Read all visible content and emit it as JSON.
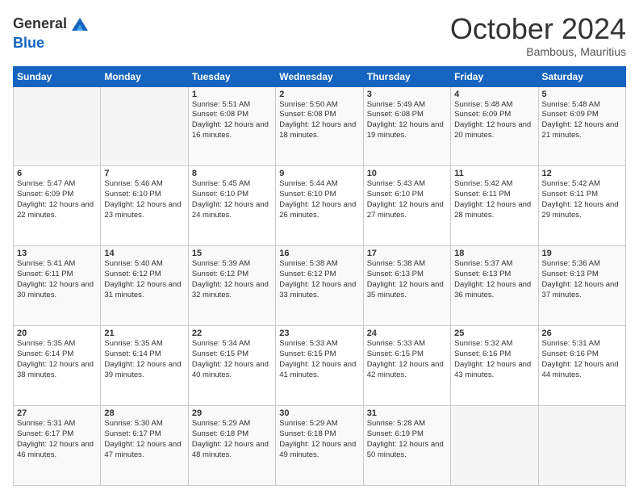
{
  "header": {
    "logo_general": "General",
    "logo_blue": "Blue",
    "month_title": "October 2024",
    "subtitle": "Bambous, Mauritius"
  },
  "weekdays": [
    "Sunday",
    "Monday",
    "Tuesday",
    "Wednesday",
    "Thursday",
    "Friday",
    "Saturday"
  ],
  "weeks": [
    [
      {
        "day": "",
        "info": ""
      },
      {
        "day": "",
        "info": ""
      },
      {
        "day": "1",
        "info": "Sunrise: 5:51 AM\nSunset: 6:08 PM\nDaylight: 12 hours and 16 minutes."
      },
      {
        "day": "2",
        "info": "Sunrise: 5:50 AM\nSunset: 6:08 PM\nDaylight: 12 hours and 18 minutes."
      },
      {
        "day": "3",
        "info": "Sunrise: 5:49 AM\nSunset: 6:08 PM\nDaylight: 12 hours and 19 minutes."
      },
      {
        "day": "4",
        "info": "Sunrise: 5:48 AM\nSunset: 6:09 PM\nDaylight: 12 hours and 20 minutes."
      },
      {
        "day": "5",
        "info": "Sunrise: 5:48 AM\nSunset: 6:09 PM\nDaylight: 12 hours and 21 minutes."
      }
    ],
    [
      {
        "day": "6",
        "info": "Sunrise: 5:47 AM\nSunset: 6:09 PM\nDaylight: 12 hours and 22 minutes."
      },
      {
        "day": "7",
        "info": "Sunrise: 5:46 AM\nSunset: 6:10 PM\nDaylight: 12 hours and 23 minutes."
      },
      {
        "day": "8",
        "info": "Sunrise: 5:45 AM\nSunset: 6:10 PM\nDaylight: 12 hours and 24 minutes."
      },
      {
        "day": "9",
        "info": "Sunrise: 5:44 AM\nSunset: 6:10 PM\nDaylight: 12 hours and 26 minutes."
      },
      {
        "day": "10",
        "info": "Sunrise: 5:43 AM\nSunset: 6:10 PM\nDaylight: 12 hours and 27 minutes."
      },
      {
        "day": "11",
        "info": "Sunrise: 5:42 AM\nSunset: 6:11 PM\nDaylight: 12 hours and 28 minutes."
      },
      {
        "day": "12",
        "info": "Sunrise: 5:42 AM\nSunset: 6:11 PM\nDaylight: 12 hours and 29 minutes."
      }
    ],
    [
      {
        "day": "13",
        "info": "Sunrise: 5:41 AM\nSunset: 6:11 PM\nDaylight: 12 hours and 30 minutes."
      },
      {
        "day": "14",
        "info": "Sunrise: 5:40 AM\nSunset: 6:12 PM\nDaylight: 12 hours and 31 minutes."
      },
      {
        "day": "15",
        "info": "Sunrise: 5:39 AM\nSunset: 6:12 PM\nDaylight: 12 hours and 32 minutes."
      },
      {
        "day": "16",
        "info": "Sunrise: 5:38 AM\nSunset: 6:12 PM\nDaylight: 12 hours and 33 minutes."
      },
      {
        "day": "17",
        "info": "Sunrise: 5:38 AM\nSunset: 6:13 PM\nDaylight: 12 hours and 35 minutes."
      },
      {
        "day": "18",
        "info": "Sunrise: 5:37 AM\nSunset: 6:13 PM\nDaylight: 12 hours and 36 minutes."
      },
      {
        "day": "19",
        "info": "Sunrise: 5:36 AM\nSunset: 6:13 PM\nDaylight: 12 hours and 37 minutes."
      }
    ],
    [
      {
        "day": "20",
        "info": "Sunrise: 5:35 AM\nSunset: 6:14 PM\nDaylight: 12 hours and 38 minutes."
      },
      {
        "day": "21",
        "info": "Sunrise: 5:35 AM\nSunset: 6:14 PM\nDaylight: 12 hours and 39 minutes."
      },
      {
        "day": "22",
        "info": "Sunrise: 5:34 AM\nSunset: 6:15 PM\nDaylight: 12 hours and 40 minutes."
      },
      {
        "day": "23",
        "info": "Sunrise: 5:33 AM\nSunset: 6:15 PM\nDaylight: 12 hours and 41 minutes."
      },
      {
        "day": "24",
        "info": "Sunrise: 5:33 AM\nSunset: 6:15 PM\nDaylight: 12 hours and 42 minutes."
      },
      {
        "day": "25",
        "info": "Sunrise: 5:32 AM\nSunset: 6:16 PM\nDaylight: 12 hours and 43 minutes."
      },
      {
        "day": "26",
        "info": "Sunrise: 5:31 AM\nSunset: 6:16 PM\nDaylight: 12 hours and 44 minutes."
      }
    ],
    [
      {
        "day": "27",
        "info": "Sunrise: 5:31 AM\nSunset: 6:17 PM\nDaylight: 12 hours and 46 minutes."
      },
      {
        "day": "28",
        "info": "Sunrise: 5:30 AM\nSunset: 6:17 PM\nDaylight: 12 hours and 47 minutes."
      },
      {
        "day": "29",
        "info": "Sunrise: 5:29 AM\nSunset: 6:18 PM\nDaylight: 12 hours and 48 minutes."
      },
      {
        "day": "30",
        "info": "Sunrise: 5:29 AM\nSunset: 6:18 PM\nDaylight: 12 hours and 49 minutes."
      },
      {
        "day": "31",
        "info": "Sunrise: 5:28 AM\nSunset: 6:19 PM\nDaylight: 12 hours and 50 minutes."
      },
      {
        "day": "",
        "info": ""
      },
      {
        "day": "",
        "info": ""
      }
    ]
  ]
}
